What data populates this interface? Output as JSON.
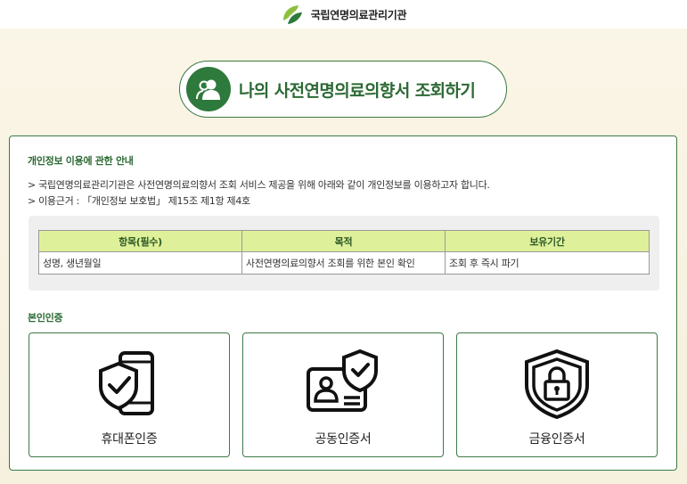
{
  "header": {
    "org_name": "국립연명의료관리기관",
    "logo_icon": "leaf-logo-icon"
  },
  "title": {
    "text": "나의 사전연명의료의향서 조회하기",
    "icon": "users-icon"
  },
  "privacy": {
    "heading": "개인정보 이용에 관한 안내",
    "line1": "> 국립연명의료관리기관은 사전연명의료의향서 조회 서비스 제공을 위해 아래와 같이 개인정보를 이용하고자 합니다.",
    "line2": "> 이용근거 : 「개인정보 보호법」 제15조 제1항 제4호",
    "table": {
      "headers": [
        "항목(필수)",
        "목적",
        "보유기간"
      ],
      "rows": [
        [
          "성명, 생년월일",
          "사전연명의료의향서 조회를 위한 본인 확인",
          "조회 후 즉시 파기"
        ]
      ]
    }
  },
  "auth": {
    "heading": "본인인증",
    "options": [
      {
        "label": "휴대폰인증",
        "icon": "mobile-shield-icon"
      },
      {
        "label": "공동인증서",
        "icon": "id-card-shield-icon"
      },
      {
        "label": "금융인증서",
        "icon": "shield-lock-icon"
      }
    ]
  },
  "colors": {
    "brand_green": "#2d6a35",
    "table_header": "#dff09a",
    "background": "#fbf6e8"
  }
}
